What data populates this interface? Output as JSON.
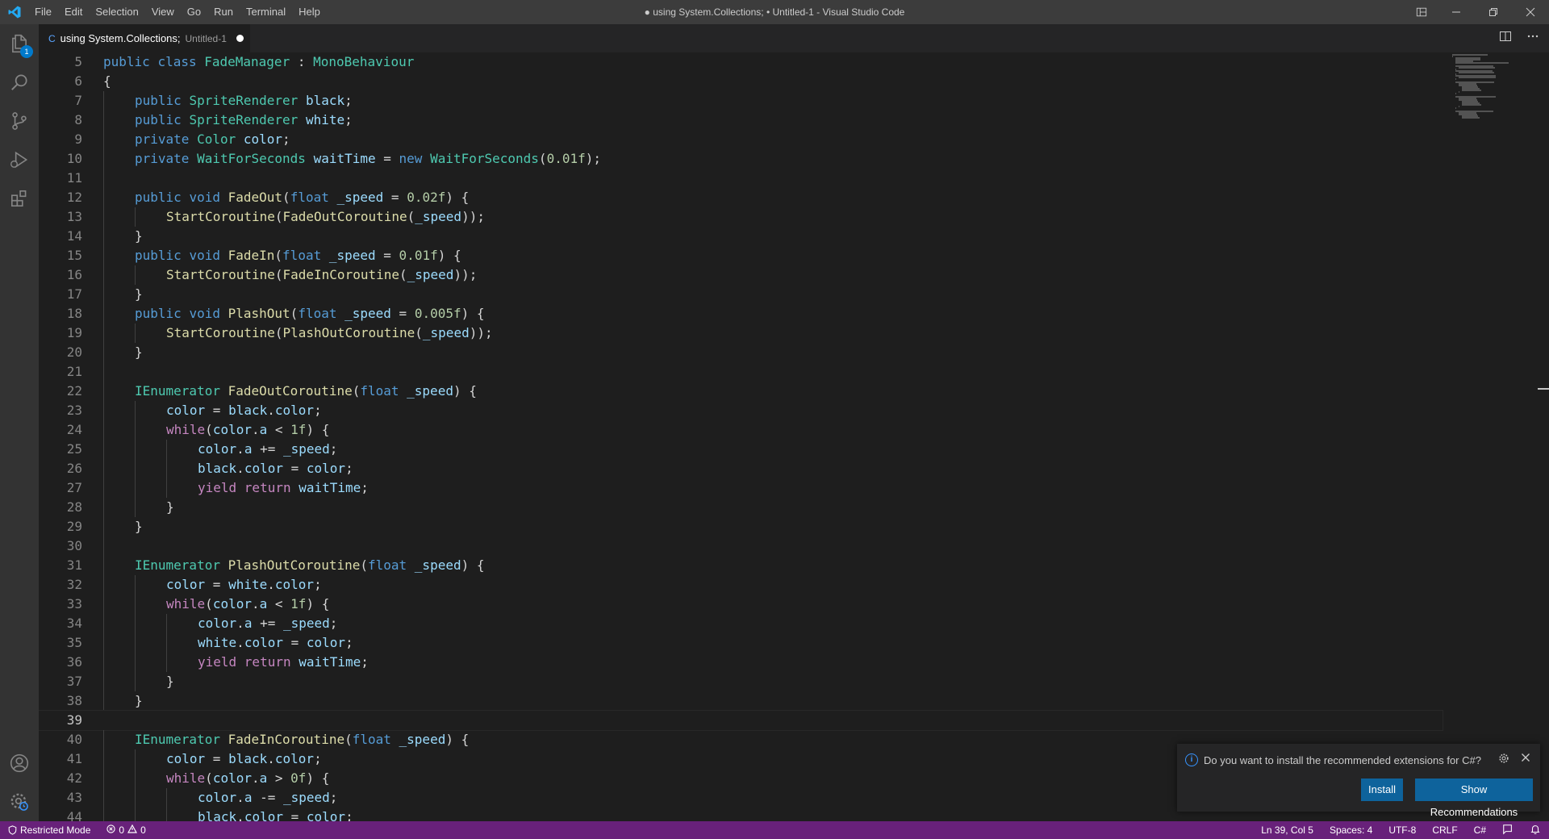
{
  "titlebar": {
    "menu": [
      "File",
      "Edit",
      "Selection",
      "View",
      "Go",
      "Run",
      "Terminal",
      "Help"
    ],
    "window_title": "● using System.Collections; • Untitled-1 - Visual Studio Code"
  },
  "activity": {
    "explorer_badge": "1"
  },
  "tab": {
    "title": "using System.Collections;",
    "description": "Untitled-1"
  },
  "editor": {
    "current_line": 39,
    "lines": [
      {
        "n": "5",
        "indent": 0,
        "tokens": [
          [
            "k",
            "public "
          ],
          [
            "k",
            "class "
          ],
          [
            "t",
            "FadeManager"
          ],
          [
            "p",
            " : "
          ],
          [
            "t",
            "MonoBehaviour"
          ]
        ]
      },
      {
        "n": "6",
        "indent": 0,
        "tokens": [
          [
            "p",
            "{"
          ]
        ]
      },
      {
        "n": "7",
        "indent": 1,
        "tokens": [
          [
            "k",
            "public "
          ],
          [
            "t",
            "SpriteRenderer "
          ],
          [
            "v",
            "black"
          ],
          [
            "p",
            ";"
          ]
        ]
      },
      {
        "n": "8",
        "indent": 1,
        "tokens": [
          [
            "k",
            "public "
          ],
          [
            "t",
            "SpriteRenderer "
          ],
          [
            "v",
            "white"
          ],
          [
            "p",
            ";"
          ]
        ]
      },
      {
        "n": "9",
        "indent": 1,
        "tokens": [
          [
            "k",
            "private "
          ],
          [
            "t",
            "Color "
          ],
          [
            "v",
            "color"
          ],
          [
            "p",
            ";"
          ]
        ]
      },
      {
        "n": "10",
        "indent": 1,
        "tokens": [
          [
            "k",
            "private "
          ],
          [
            "t",
            "WaitForSeconds "
          ],
          [
            "v",
            "waitTime"
          ],
          [
            "p",
            " = "
          ],
          [
            "k",
            "new "
          ],
          [
            "t",
            "WaitForSeconds"
          ],
          [
            "p",
            "("
          ],
          [
            "n",
            "0.01f"
          ],
          [
            "p",
            ");"
          ]
        ]
      },
      {
        "n": "11",
        "indent": 1,
        "tokens": []
      },
      {
        "n": "12",
        "indent": 1,
        "tokens": [
          [
            "k",
            "public "
          ],
          [
            "k",
            "void "
          ],
          [
            "f",
            "FadeOut"
          ],
          [
            "p",
            "("
          ],
          [
            "k",
            "float "
          ],
          [
            "v",
            "_speed"
          ],
          [
            "p",
            " = "
          ],
          [
            "n",
            "0.02f"
          ],
          [
            "p",
            ") {"
          ]
        ]
      },
      {
        "n": "13",
        "indent": 2,
        "tokens": [
          [
            "f",
            "StartCoroutine"
          ],
          [
            "p",
            "("
          ],
          [
            "f",
            "FadeOutCoroutine"
          ],
          [
            "p",
            "("
          ],
          [
            "v",
            "_speed"
          ],
          [
            "p",
            "));"
          ]
        ]
      },
      {
        "n": "14",
        "indent": 1,
        "tokens": [
          [
            "p",
            "}"
          ]
        ]
      },
      {
        "n": "15",
        "indent": 1,
        "tokens": [
          [
            "k",
            "public "
          ],
          [
            "k",
            "void "
          ],
          [
            "f",
            "FadeIn"
          ],
          [
            "p",
            "("
          ],
          [
            "k",
            "float "
          ],
          [
            "v",
            "_speed"
          ],
          [
            "p",
            " = "
          ],
          [
            "n",
            "0.01f"
          ],
          [
            "p",
            ") {"
          ]
        ]
      },
      {
        "n": "16",
        "indent": 2,
        "tokens": [
          [
            "f",
            "StartCoroutine"
          ],
          [
            "p",
            "("
          ],
          [
            "f",
            "FadeInCoroutine"
          ],
          [
            "p",
            "("
          ],
          [
            "v",
            "_speed"
          ],
          [
            "p",
            "));"
          ]
        ]
      },
      {
        "n": "17",
        "indent": 1,
        "tokens": [
          [
            "p",
            "}"
          ]
        ]
      },
      {
        "n": "18",
        "indent": 1,
        "tokens": [
          [
            "k",
            "public "
          ],
          [
            "k",
            "void "
          ],
          [
            "f",
            "PlashOut"
          ],
          [
            "p",
            "("
          ],
          [
            "k",
            "float "
          ],
          [
            "v",
            "_speed"
          ],
          [
            "p",
            " = "
          ],
          [
            "n",
            "0.005f"
          ],
          [
            "p",
            ") {"
          ]
        ]
      },
      {
        "n": "19",
        "indent": 2,
        "tokens": [
          [
            "f",
            "StartCoroutine"
          ],
          [
            "p",
            "("
          ],
          [
            "f",
            "PlashOutCoroutine"
          ],
          [
            "p",
            "("
          ],
          [
            "v",
            "_speed"
          ],
          [
            "p",
            "));"
          ]
        ]
      },
      {
        "n": "20",
        "indent": 1,
        "tokens": [
          [
            "p",
            "}"
          ]
        ]
      },
      {
        "n": "21",
        "indent": 1,
        "tokens": []
      },
      {
        "n": "22",
        "indent": 1,
        "tokens": [
          [
            "t",
            "IEnumerator "
          ],
          [
            "f",
            "FadeOutCoroutine"
          ],
          [
            "p",
            "("
          ],
          [
            "k",
            "float "
          ],
          [
            "v",
            "_speed"
          ],
          [
            "p",
            ") {"
          ]
        ]
      },
      {
        "n": "23",
        "indent": 2,
        "tokens": [
          [
            "v",
            "color"
          ],
          [
            "p",
            " = "
          ],
          [
            "v",
            "black"
          ],
          [
            "p",
            "."
          ],
          [
            "v",
            "color"
          ],
          [
            "p",
            ";"
          ]
        ]
      },
      {
        "n": "24",
        "indent": 2,
        "tokens": [
          [
            "c",
            "while"
          ],
          [
            "p",
            "("
          ],
          [
            "v",
            "color"
          ],
          [
            "p",
            "."
          ],
          [
            "v",
            "a"
          ],
          [
            "p",
            " < "
          ],
          [
            "n",
            "1f"
          ],
          [
            "p",
            ") {"
          ]
        ]
      },
      {
        "n": "25",
        "indent": 3,
        "tokens": [
          [
            "v",
            "color"
          ],
          [
            "p",
            "."
          ],
          [
            "v",
            "a"
          ],
          [
            "p",
            " += "
          ],
          [
            "v",
            "_speed"
          ],
          [
            "p",
            ";"
          ]
        ]
      },
      {
        "n": "26",
        "indent": 3,
        "tokens": [
          [
            "v",
            "black"
          ],
          [
            "p",
            "."
          ],
          [
            "v",
            "color"
          ],
          [
            "p",
            " = "
          ],
          [
            "v",
            "color"
          ],
          [
            "p",
            ";"
          ]
        ]
      },
      {
        "n": "27",
        "indent": 3,
        "tokens": [
          [
            "c",
            "yield "
          ],
          [
            "c",
            "return "
          ],
          [
            "v",
            "waitTime"
          ],
          [
            "p",
            ";"
          ]
        ]
      },
      {
        "n": "28",
        "indent": 2,
        "tokens": [
          [
            "p",
            "}"
          ]
        ]
      },
      {
        "n": "29",
        "indent": 1,
        "tokens": [
          [
            "p",
            "}"
          ]
        ]
      },
      {
        "n": "30",
        "indent": 1,
        "tokens": []
      },
      {
        "n": "31",
        "indent": 1,
        "tokens": [
          [
            "t",
            "IEnumerator "
          ],
          [
            "f",
            "PlashOutCoroutine"
          ],
          [
            "p",
            "("
          ],
          [
            "k",
            "float "
          ],
          [
            "v",
            "_speed"
          ],
          [
            "p",
            ") {"
          ]
        ]
      },
      {
        "n": "32",
        "indent": 2,
        "tokens": [
          [
            "v",
            "color"
          ],
          [
            "p",
            " = "
          ],
          [
            "v",
            "white"
          ],
          [
            "p",
            "."
          ],
          [
            "v",
            "color"
          ],
          [
            "p",
            ";"
          ]
        ]
      },
      {
        "n": "33",
        "indent": 2,
        "tokens": [
          [
            "c",
            "while"
          ],
          [
            "p",
            "("
          ],
          [
            "v",
            "color"
          ],
          [
            "p",
            "."
          ],
          [
            "v",
            "a"
          ],
          [
            "p",
            " < "
          ],
          [
            "n",
            "1f"
          ],
          [
            "p",
            ") {"
          ]
        ]
      },
      {
        "n": "34",
        "indent": 3,
        "tokens": [
          [
            "v",
            "color"
          ],
          [
            "p",
            "."
          ],
          [
            "v",
            "a"
          ],
          [
            "p",
            " += "
          ],
          [
            "v",
            "_speed"
          ],
          [
            "p",
            ";"
          ]
        ]
      },
      {
        "n": "35",
        "indent": 3,
        "tokens": [
          [
            "v",
            "white"
          ],
          [
            "p",
            "."
          ],
          [
            "v",
            "color"
          ],
          [
            "p",
            " = "
          ],
          [
            "v",
            "color"
          ],
          [
            "p",
            ";"
          ]
        ]
      },
      {
        "n": "36",
        "indent": 3,
        "tokens": [
          [
            "c",
            "yield "
          ],
          [
            "c",
            "return "
          ],
          [
            "v",
            "waitTime"
          ],
          [
            "p",
            ";"
          ]
        ]
      },
      {
        "n": "37",
        "indent": 2,
        "tokens": [
          [
            "p",
            "}"
          ]
        ]
      },
      {
        "n": "38",
        "indent": 1,
        "tokens": [
          [
            "p",
            "}"
          ]
        ]
      },
      {
        "n": "39",
        "indent": 0,
        "tokens": []
      },
      {
        "n": "40",
        "indent": 1,
        "tokens": [
          [
            "t",
            "IEnumerator "
          ],
          [
            "f",
            "FadeInCoroutine"
          ],
          [
            "p",
            "("
          ],
          [
            "k",
            "float "
          ],
          [
            "v",
            "_speed"
          ],
          [
            "p",
            ") {"
          ]
        ]
      },
      {
        "n": "41",
        "indent": 2,
        "tokens": [
          [
            "v",
            "color"
          ],
          [
            "p",
            " = "
          ],
          [
            "v",
            "black"
          ],
          [
            "p",
            "."
          ],
          [
            "v",
            "color"
          ],
          [
            "p",
            ";"
          ]
        ]
      },
      {
        "n": "42",
        "indent": 2,
        "tokens": [
          [
            "c",
            "while"
          ],
          [
            "p",
            "("
          ],
          [
            "v",
            "color"
          ],
          [
            "p",
            "."
          ],
          [
            "v",
            "a"
          ],
          [
            "p",
            " > "
          ],
          [
            "n",
            "0f"
          ],
          [
            "p",
            ") {"
          ]
        ]
      },
      {
        "n": "43",
        "indent": 3,
        "tokens": [
          [
            "v",
            "color"
          ],
          [
            "p",
            "."
          ],
          [
            "v",
            "a"
          ],
          [
            "p",
            " -= "
          ],
          [
            "v",
            "_speed"
          ],
          [
            "p",
            ";"
          ]
        ]
      },
      {
        "n": "44",
        "indent": 3,
        "tokens": [
          [
            "v",
            "black"
          ],
          [
            "p",
            "."
          ],
          [
            "v",
            "color"
          ],
          [
            "p",
            " = "
          ],
          [
            "v",
            "color"
          ],
          [
            "p",
            ";"
          ]
        ]
      }
    ]
  },
  "notification": {
    "message": "Do you want to install the recommended extensions for C#?",
    "install_label": "Install",
    "show_label": "Show Recommendations"
  },
  "statusbar": {
    "restricted": "Restricted Mode",
    "errors": "0",
    "warnings": "0",
    "position": "Ln 39, Col 5",
    "spaces": "Spaces: 4",
    "encoding": "UTF-8",
    "eol": "CRLF",
    "language": "C#"
  },
  "colors": {
    "statusbar": "#68217a",
    "accent": "#007acc",
    "button": "#0e639c"
  }
}
